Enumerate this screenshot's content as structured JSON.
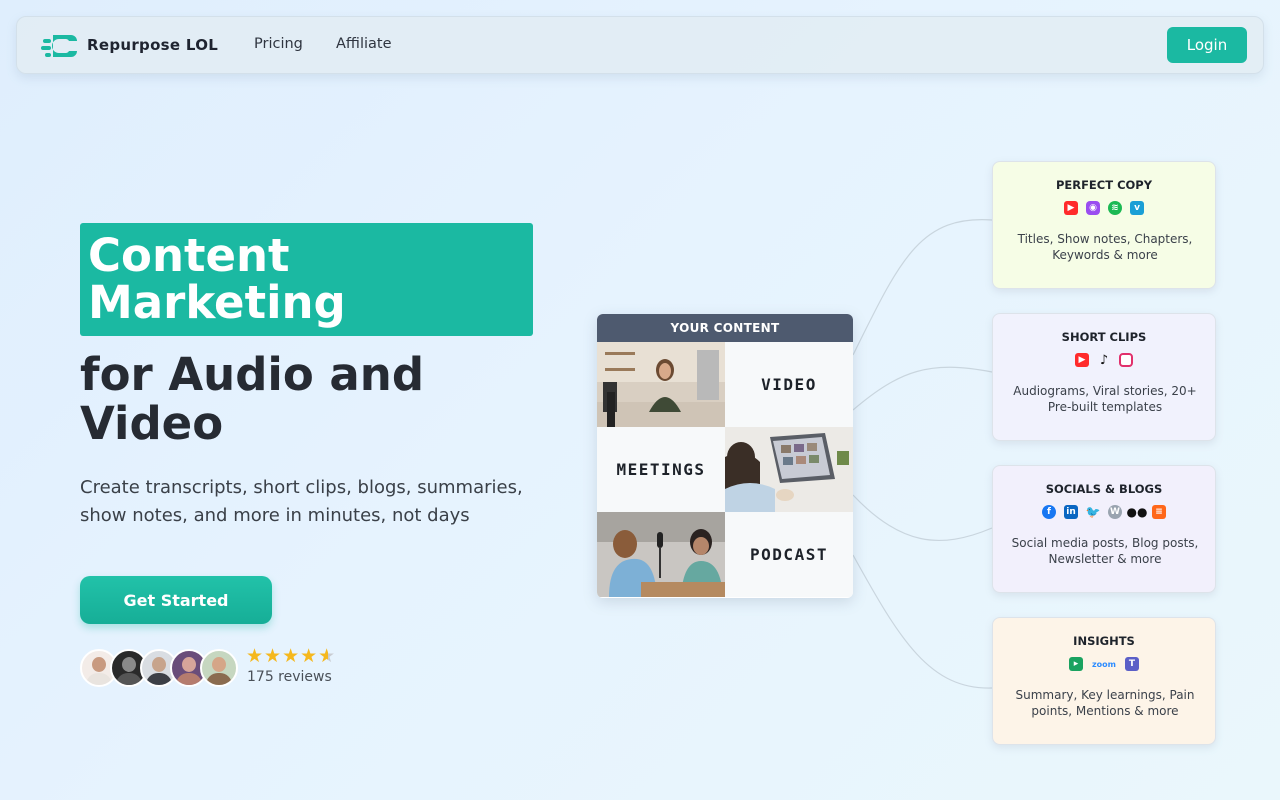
{
  "nav": {
    "brand": "Repurpose LOL",
    "links": [
      "Pricing",
      "Affiliate"
    ],
    "login": "Login"
  },
  "hero": {
    "highlight_line1": "Content",
    "highlight_line2": "Marketing",
    "title_line1": "for Audio and",
    "title_line2": "Video",
    "subtitle": "Create transcripts, short clips, blogs, summaries, show notes, and more in minutes, not days",
    "cta": "Get Started",
    "rating": 4.5,
    "reviews": "175 reviews",
    "stars": "★★★★",
    "half_star": "★"
  },
  "content_grid": {
    "header": "YOUR CONTENT",
    "labels": [
      "VIDEO",
      "MEETINGS",
      "PODCAST"
    ]
  },
  "cards": [
    {
      "title": "PERFECT COPY",
      "icons": [
        "youtube-icon",
        "apple-podcasts-icon",
        "spotify-icon",
        "vimeo-icon"
      ],
      "desc": "Titles, Show notes, Chapters, Keywords & more",
      "bg": "#f6fde6"
    },
    {
      "title": "SHORT CLIPS",
      "icons": [
        "youtube-icon",
        "tiktok-icon",
        "instagram-icon"
      ],
      "desc": "Audiograms, Viral stories, 20+ Pre-built templates",
      "bg": "#f1f2fd"
    },
    {
      "title": "SOCIALS & BLOGS",
      "icons": [
        "facebook-icon",
        "linkedin-icon",
        "twitter-icon",
        "wordpress-icon",
        "medium-icon",
        "substack-icon"
      ],
      "desc": "Social media posts, Blog posts, Newsletter & more",
      "bg": "#f2f0fc"
    },
    {
      "title": "INSIGHTS",
      "icons": [
        "google-meet-icon",
        "zoom-icon",
        "teams-icon"
      ],
      "desc": "Summary, Key learnings, Pain points, Mentions & more",
      "bg": "#fdf4e8"
    }
  ],
  "icon_text": {
    "zoom": "zoom"
  },
  "colors": {
    "accent": "#1bb9a2",
    "dark_header": "#4e5a6f",
    "star": "#f5b81e"
  }
}
